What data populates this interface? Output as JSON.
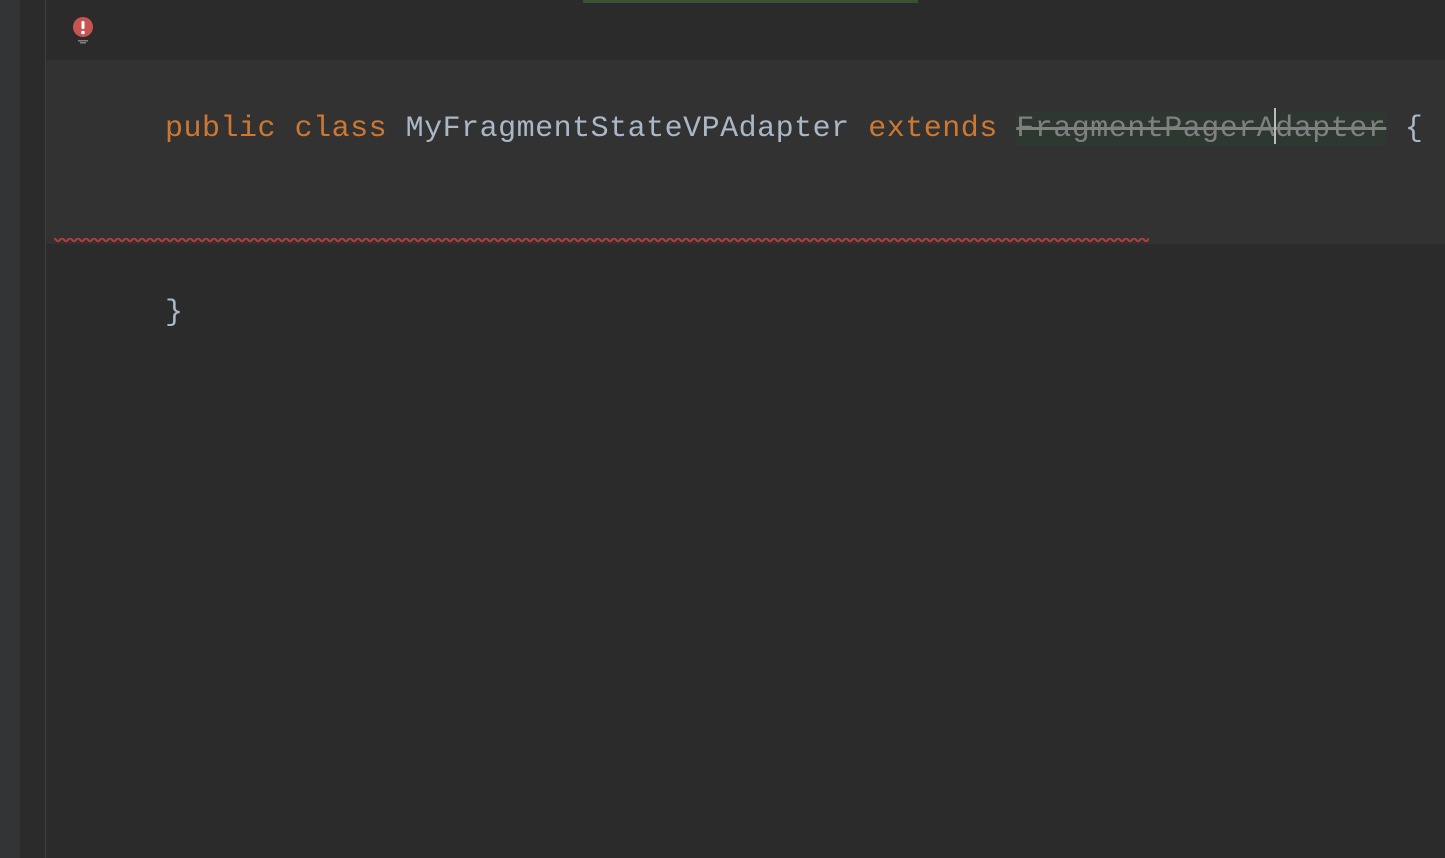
{
  "editor": {
    "intention_bulb": {
      "icon_name": "error-lightbulb",
      "has_dropdown": true
    },
    "line1": {
      "tokens": {
        "public": "public",
        "class": "class",
        "class_name": "MyFragmentStateVPAdapter",
        "extends": "extends",
        "parent_class": "FragmentPagerAdapter",
        "open_brace": "{"
      }
    },
    "line2": {
      "close_brace": "}"
    }
  }
}
